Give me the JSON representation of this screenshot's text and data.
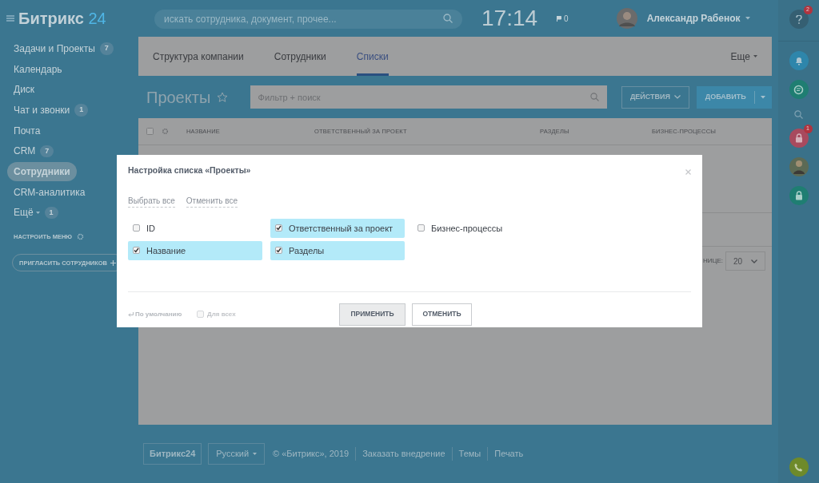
{
  "header": {
    "logo": "Битрикс",
    "logo_accent": "24",
    "search": {
      "placeholder": "искать сотрудника, документ, прочее..."
    },
    "clock": "17:14",
    "flags": "0",
    "user": "Александр Рабенок"
  },
  "sidebar": {
    "items": [
      {
        "label": "Задачи и Проекты",
        "counter": "7",
        "selected": false
      },
      {
        "label": "Календарь",
        "selected": false
      },
      {
        "label": "Диск",
        "selected": false
      },
      {
        "label": "Чат и звонки",
        "counter": "1",
        "selected": false
      },
      {
        "label": "Почта",
        "selected": false
      },
      {
        "label": "CRM",
        "counter": "7",
        "selected": false
      },
      {
        "label": "Сотрудники",
        "selected": true
      },
      {
        "label": "CRM-аналитика",
        "selected": false
      },
      {
        "label": "Ещё",
        "counter": "1",
        "selected": false,
        "dropdown": true
      }
    ],
    "configure": "НАСТРОИТЬ МЕНЮ",
    "invite": "ПРИГЛАСИТЬ СОТРУДНИКОВ"
  },
  "tabs": [
    {
      "label": "Структура компании",
      "selected": false
    },
    {
      "label": "Сотрудники",
      "selected": false
    },
    {
      "label": "Списки",
      "selected": true
    }
  ],
  "more_tab": "Еще",
  "page_title": "Проекты",
  "filter": {
    "placeholder": "Фильтр + поиск"
  },
  "actions_button": "ДЕЙСТВИЯ",
  "add_button": "ДОБАВИТЬ",
  "table": {
    "columns": [
      "НАЗВАНИЕ",
      "ОТВЕТСТВЕННЫЙ ЗА ПРОЕКТ",
      "РАЗДЕЛЫ",
      "БИЗНЕС-ПРОЦЕССЫ"
    ],
    "page_size_label": "НИЦЕ:",
    "page_size": "20"
  },
  "modal": {
    "title": "Настройка списка «Проекты»",
    "select_all": "Выбрать все",
    "deselect_all": "Отменить все",
    "fields": [
      {
        "label": "ID",
        "checked": false
      },
      {
        "label": "Ответственный за проект",
        "checked": true
      },
      {
        "label": "Бизнес-процессы",
        "checked": false
      },
      {
        "label": "Название",
        "checked": true
      },
      {
        "label": "Разделы",
        "checked": true
      }
    ],
    "reset": "По умолчанию",
    "for_all": {
      "label": "Для всех",
      "checked": false
    },
    "apply": "ПРИМЕНИТЬ",
    "cancel": "ОТМЕНИТЬ"
  },
  "right_bar": {
    "help_badge": "2",
    "lock_badge": "1"
  },
  "footer": {
    "logo": "Битрикс24",
    "language": "Русский",
    "copyright": "© «Битрикс», 2019",
    "links": [
      "Заказать внедрение",
      "Темы",
      "Печать"
    ]
  }
}
